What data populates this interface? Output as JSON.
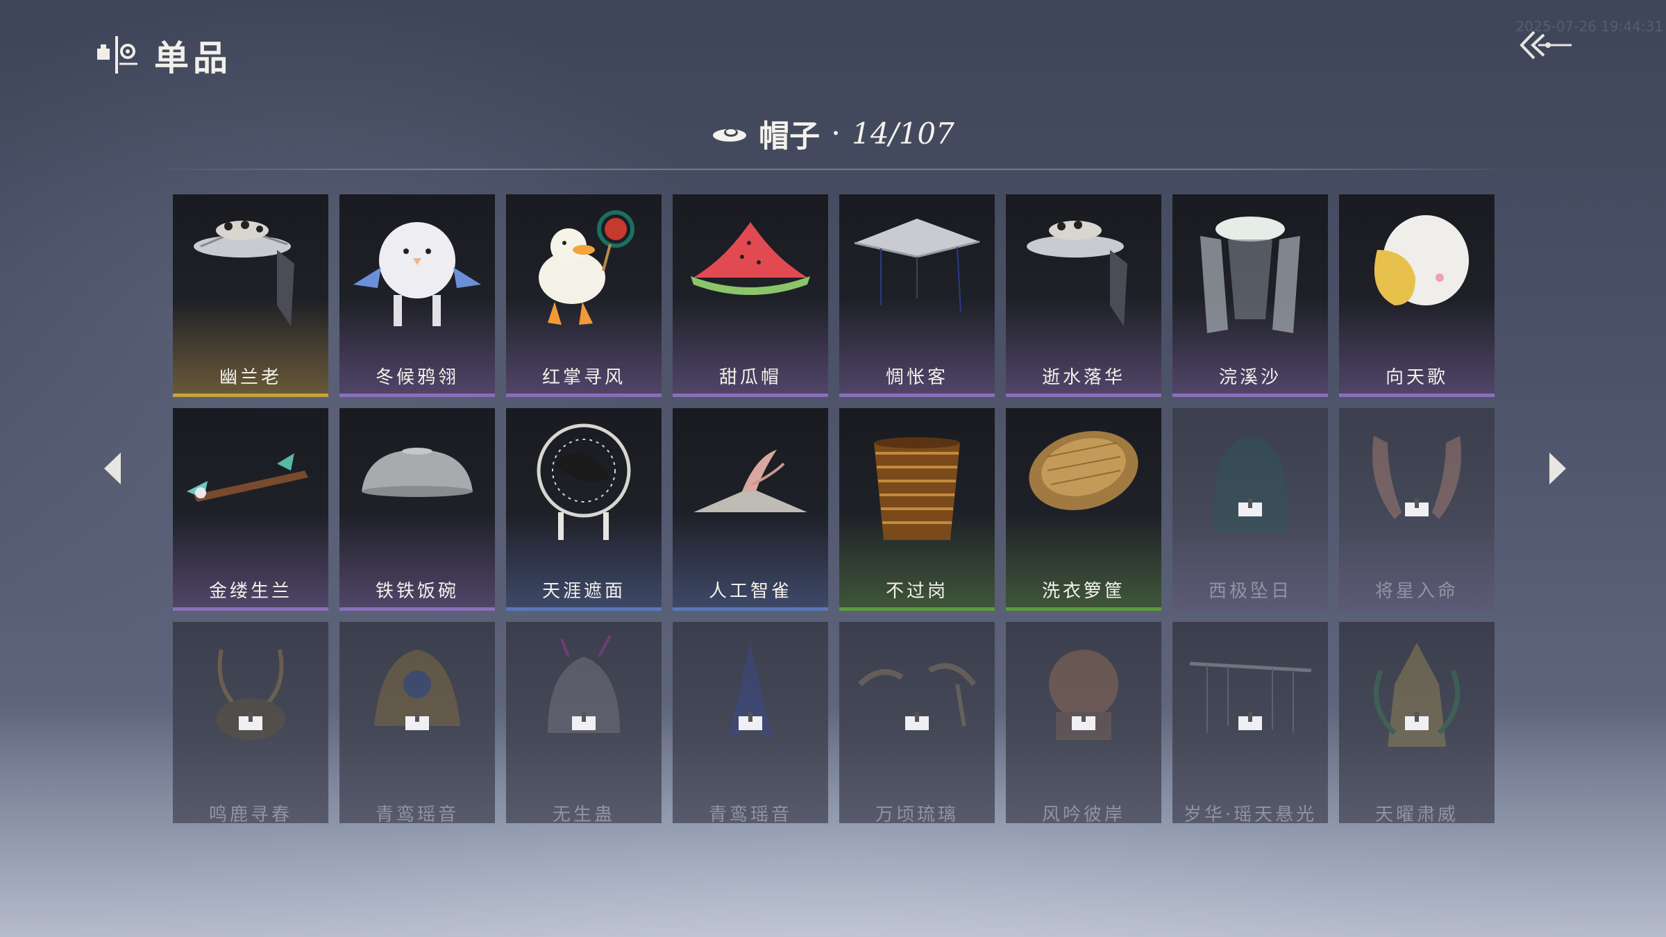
{
  "header": {
    "title": "单品",
    "timestamp": "2025-07-26 19:44:31"
  },
  "category": {
    "label": "帽子",
    "separator": "·",
    "count": "14/107",
    "icon": "hat-icon"
  },
  "colors": {
    "gold": "#c9a23a",
    "purple": "#8a6fb8",
    "blue": "#5a78b8",
    "green": "#5d9a3e",
    "locked": "#6b6f80"
  },
  "items": [
    {
      "name": "幽兰老",
      "rarity": "gold",
      "locked": false,
      "icon": "lantern-hat-icon"
    },
    {
      "name": "冬候鸦翎",
      "rarity": "purple",
      "locked": false,
      "icon": "plush-bird-hat-icon"
    },
    {
      "name": "红掌寻风",
      "rarity": "purple",
      "locked": false,
      "icon": "duck-hat-icon"
    },
    {
      "name": "甜瓜帽",
      "rarity": "purple",
      "locked": false,
      "icon": "melon-hat-icon"
    },
    {
      "name": "惆怅客",
      "rarity": "purple",
      "locked": false,
      "icon": "straw-hat-icon"
    },
    {
      "name": "逝水落华",
      "rarity": "purple",
      "locked": false,
      "icon": "veil-hat-icon"
    },
    {
      "name": "浣溪沙",
      "rarity": "purple",
      "locked": false,
      "icon": "lotus-veil-icon"
    },
    {
      "name": "向天歌",
      "rarity": "purple",
      "locked": false,
      "icon": "goose-hood-icon"
    },
    {
      "name": "金缕生兰",
      "rarity": "purple",
      "locked": false,
      "icon": "hairpin-icon"
    },
    {
      "name": "铁铁饭碗",
      "rarity": "purple",
      "locked": false,
      "icon": "iron-bowl-icon"
    },
    {
      "name": "天涯遮面",
      "rarity": "blue",
      "locked": false,
      "icon": "fan-hat-icon"
    },
    {
      "name": "人工智雀",
      "rarity": "blue",
      "locked": false,
      "icon": "bird-hat-icon"
    },
    {
      "name": "不过岗",
      "rarity": "green",
      "locked": false,
      "icon": "bowl-stack-icon"
    },
    {
      "name": "洗衣箩筐",
      "rarity": "green",
      "locked": false,
      "icon": "basket-icon"
    },
    {
      "name": "西极坠日",
      "rarity": "purple",
      "locked": true,
      "icon": "hood-icon"
    },
    {
      "name": "将星入命",
      "rarity": "purple",
      "locked": true,
      "icon": "feather-helm-icon"
    },
    {
      "name": "鸣鹿寻春",
      "rarity": "locked",
      "locked": true,
      "icon": "antler-crown-icon"
    },
    {
      "name": "青鸾瑶音",
      "rarity": "locked",
      "locked": true,
      "icon": "phoenix-crown-icon"
    },
    {
      "name": "无生蛊",
      "rarity": "locked",
      "locked": true,
      "icon": "insect-crown-icon"
    },
    {
      "name": "青鸾瑶音",
      "rarity": "locked",
      "locked": true,
      "icon": "plume-icon"
    },
    {
      "name": "万顷琉璃",
      "rarity": "locked",
      "locked": true,
      "icon": "glass-crown-icon"
    },
    {
      "name": "风吟彼岸",
      "rarity": "locked",
      "locked": true,
      "icon": "flower-crown-icon"
    },
    {
      "name": "岁华·瑶天悬光",
      "rarity": "locked",
      "locked": true,
      "icon": "beaded-hat-icon"
    },
    {
      "name": "天曜肃威",
      "rarity": "locked",
      "locked": true,
      "icon": "dragon-helm-icon"
    }
  ]
}
